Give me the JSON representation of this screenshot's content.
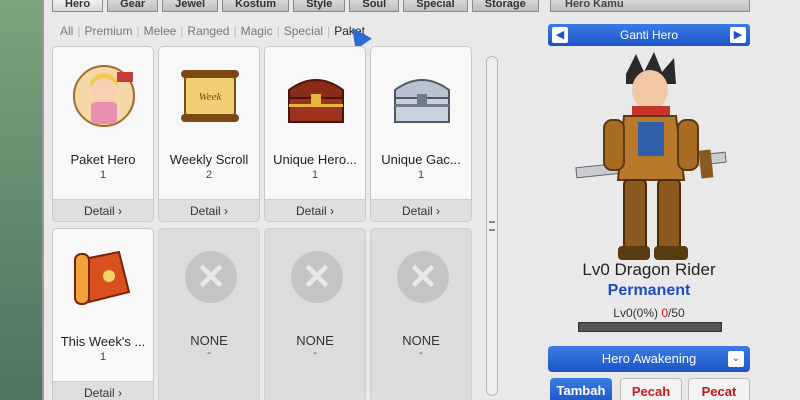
{
  "tabs": [
    "Hero",
    "Gear",
    "Jewel",
    "Kostum",
    "Style",
    "Soul",
    "Special",
    "Storage"
  ],
  "right_tab": "Hero Kamu",
  "filters": [
    "All",
    "Premium",
    "Melee",
    "Ranged",
    "Magic",
    "Special",
    "Paket"
  ],
  "items": [
    {
      "name": "Paket Hero",
      "count": "1",
      "detail": "Detail"
    },
    {
      "name": "Weekly Scroll",
      "count": "2",
      "detail": "Detail"
    },
    {
      "name": "Unique Hero...",
      "count": "1",
      "detail": "Detail"
    },
    {
      "name": "Unique Gac...",
      "count": "1",
      "detail": "Detail"
    },
    {
      "name": "This Week's ...",
      "count": "1",
      "detail": "Detail"
    },
    {
      "name": "NONE",
      "count": "-"
    },
    {
      "name": "NONE",
      "count": "-"
    },
    {
      "name": "NONE",
      "count": "-"
    }
  ],
  "hero": {
    "ganti_label": "Ganti Hero",
    "title": "Lv0 Dragon Rider",
    "status": "Permanent",
    "lv_prefix": "Lv0(0%) ",
    "lv_current": "0",
    "lv_max": "/50",
    "awakening_label": "Hero Awakening",
    "buttons": {
      "tambah": "Tambah",
      "pecah": "Pecah",
      "pecat": "Pecat"
    }
  },
  "icons": {
    "prev": "◀",
    "next": "▶",
    "chevron": "⌄",
    "detail_arrow": "›",
    "x": "✕"
  }
}
